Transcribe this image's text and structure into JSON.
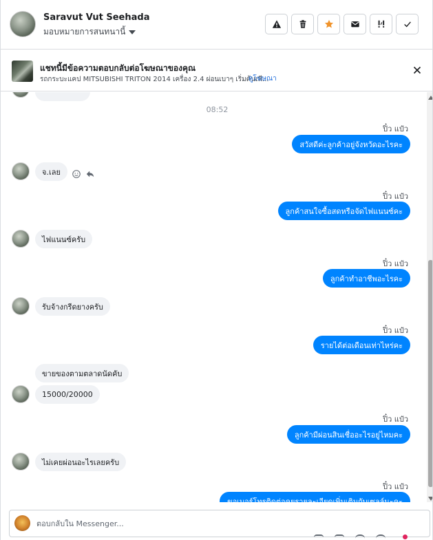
{
  "header": {
    "contact_name": "Saravut Vut Seehada",
    "assign_label": "มอบหมายการสนทนานี้",
    "actions": [
      {
        "name": "report-spam-button",
        "icon": "warning-icon"
      },
      {
        "name": "delete-button",
        "icon": "trash-icon"
      },
      {
        "name": "star-button",
        "icon": "star-icon"
      },
      {
        "name": "mark-unread-button",
        "icon": "envelope-icon"
      },
      {
        "name": "follow-up-button",
        "icon": "exclamation-icon"
      },
      {
        "name": "mark-done-button",
        "icon": "check-icon"
      }
    ]
  },
  "banner": {
    "title": "แชทนี้มีข้อความตอบกลับต่อโฆษณาของคุณ",
    "subtitle": "รถกระบะแคป MITSUBISHI TRITON 2014 เครื่อง 2.4 ผ่อนเบาๆ เริ่มต้นเพี...",
    "link": "ดูโฆษณา"
  },
  "conversation": {
    "timestamp": "08:52",
    "sender_name": "ปิ๋ว แป๋ว",
    "messages": [
      {
        "dir": "out",
        "text": "สวัสดีค่ะลูกค้าอยู่จังหวัดอะไรคะ"
      },
      {
        "dir": "in",
        "text": "จ.เลย"
      },
      {
        "dir": "out",
        "text": "ลูกค้าสนใจซื้อสดหรือจัดไฟแนนซ์คะ"
      },
      {
        "dir": "in",
        "text": "ไฟแนนซ์ครับ"
      },
      {
        "dir": "out",
        "text": "ลูกค้าทำอาชีพอะไรคะ"
      },
      {
        "dir": "in",
        "text": "รับจ้างกรีดยางครับ"
      },
      {
        "dir": "out",
        "text": "รายได้ต่อเดือนเท่าไหร่คะ"
      },
      {
        "dir": "in",
        "text": "ขายของตามตลาดนัดคับ"
      },
      {
        "dir": "in",
        "text": "15000/20000"
      },
      {
        "dir": "out",
        "text": "ลูกค้ามีผ่อนสินเชื่ออะไรอยู่ไหมคะ"
      },
      {
        "dir": "in",
        "text": "ไม่เคยผ่อนอะไรเลยครับ"
      },
      {
        "dir": "out",
        "text": "ขอเบอร์โทรติดต่อคุยรายละเอียดเพิ่มเติมกับเซลล์นะคะ"
      }
    ]
  },
  "composer": {
    "placeholder": "ตอบกลับใน Messenger..."
  },
  "colors": {
    "outgoing_bubble": "#0084ff",
    "incoming_bubble": "#f0f2f5",
    "link": "#216fdb",
    "star": "#f0932b"
  }
}
